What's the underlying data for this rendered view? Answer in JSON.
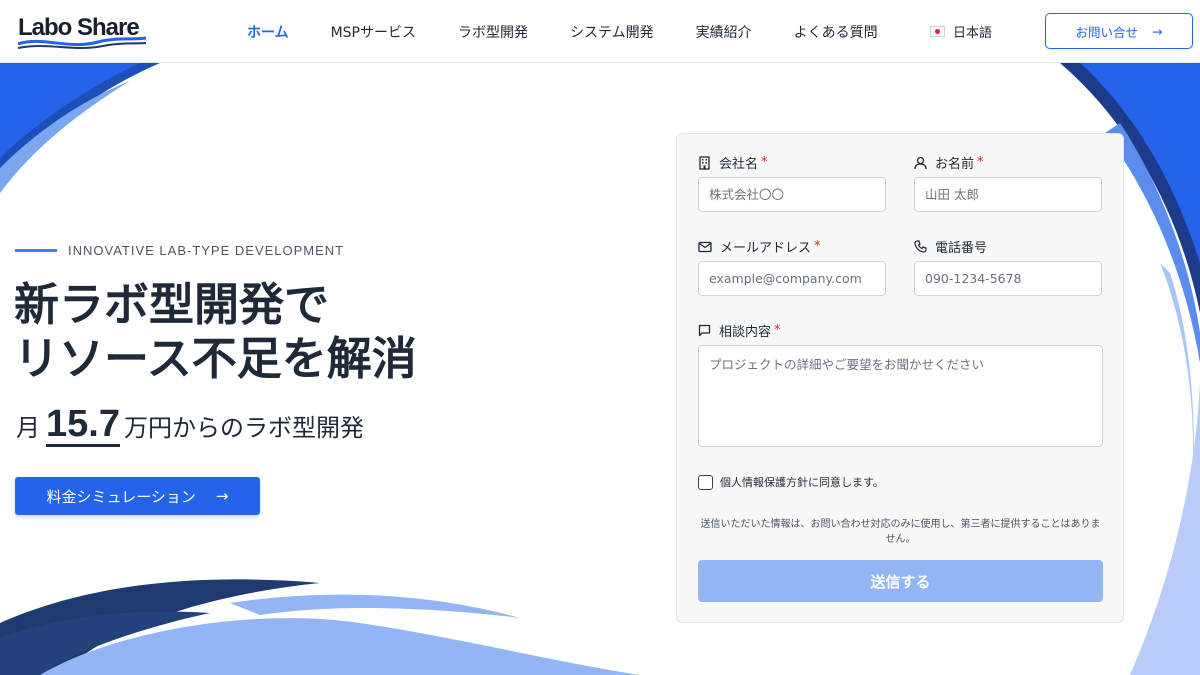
{
  "header": {
    "logo": "Labo Share",
    "nav": [
      {
        "label": "ホーム",
        "active": true
      },
      {
        "label": "MSPサービス",
        "active": false
      },
      {
        "label": "ラボ型開発",
        "active": false
      },
      {
        "label": "システム開発",
        "active": false
      },
      {
        "label": "実績紹介",
        "active": false
      },
      {
        "label": "よくある質問",
        "active": false
      }
    ],
    "language": "日本語",
    "contact_button": "お問い合せ",
    "contact_arrow": "→"
  },
  "hero": {
    "tagline": "INNOVATIVE LAB-TYPE DEVELOPMENT",
    "headline_line1": "新ラボ型開発で",
    "headline_line2": "リソース不足を解消",
    "price_prefix": "月",
    "price_value": "15.7",
    "price_suffix": "万円からのラボ型開発",
    "cta": "料金シミュレーション",
    "cta_arrow": "→"
  },
  "form": {
    "company": {
      "label": "会社名",
      "required_mark": "*",
      "placeholder": "株式会社〇〇"
    },
    "name": {
      "label": "お名前",
      "required_mark": "*",
      "placeholder": "山田 太郎"
    },
    "email": {
      "label": "メールアドレス",
      "required_mark": "*",
      "placeholder": "example@company.com"
    },
    "phone": {
      "label": "電話番号",
      "placeholder": "090-1234-5678"
    },
    "message": {
      "label": "相談内容",
      "required_mark": "*",
      "placeholder": "プロジェクトの詳細やご要望をお聞かせください"
    },
    "consent": "個人情報保護方針に同意します。",
    "notice": "送信いただいた情報は、お問い合わせ対応のみに使用し、第三者に提供することはありません。",
    "submit": "送信する"
  },
  "colors": {
    "accent": "#2563eb",
    "dark_wave": "#1e3a6e",
    "light_wave": "#93b4f5",
    "submit_disabled": "#93b4f5",
    "required": "#dc2626"
  },
  "icons": [
    "building-icon",
    "user-icon",
    "mail-icon",
    "phone-icon",
    "chat-icon",
    "arrow-right-icon",
    "japan-flag-icon"
  ]
}
